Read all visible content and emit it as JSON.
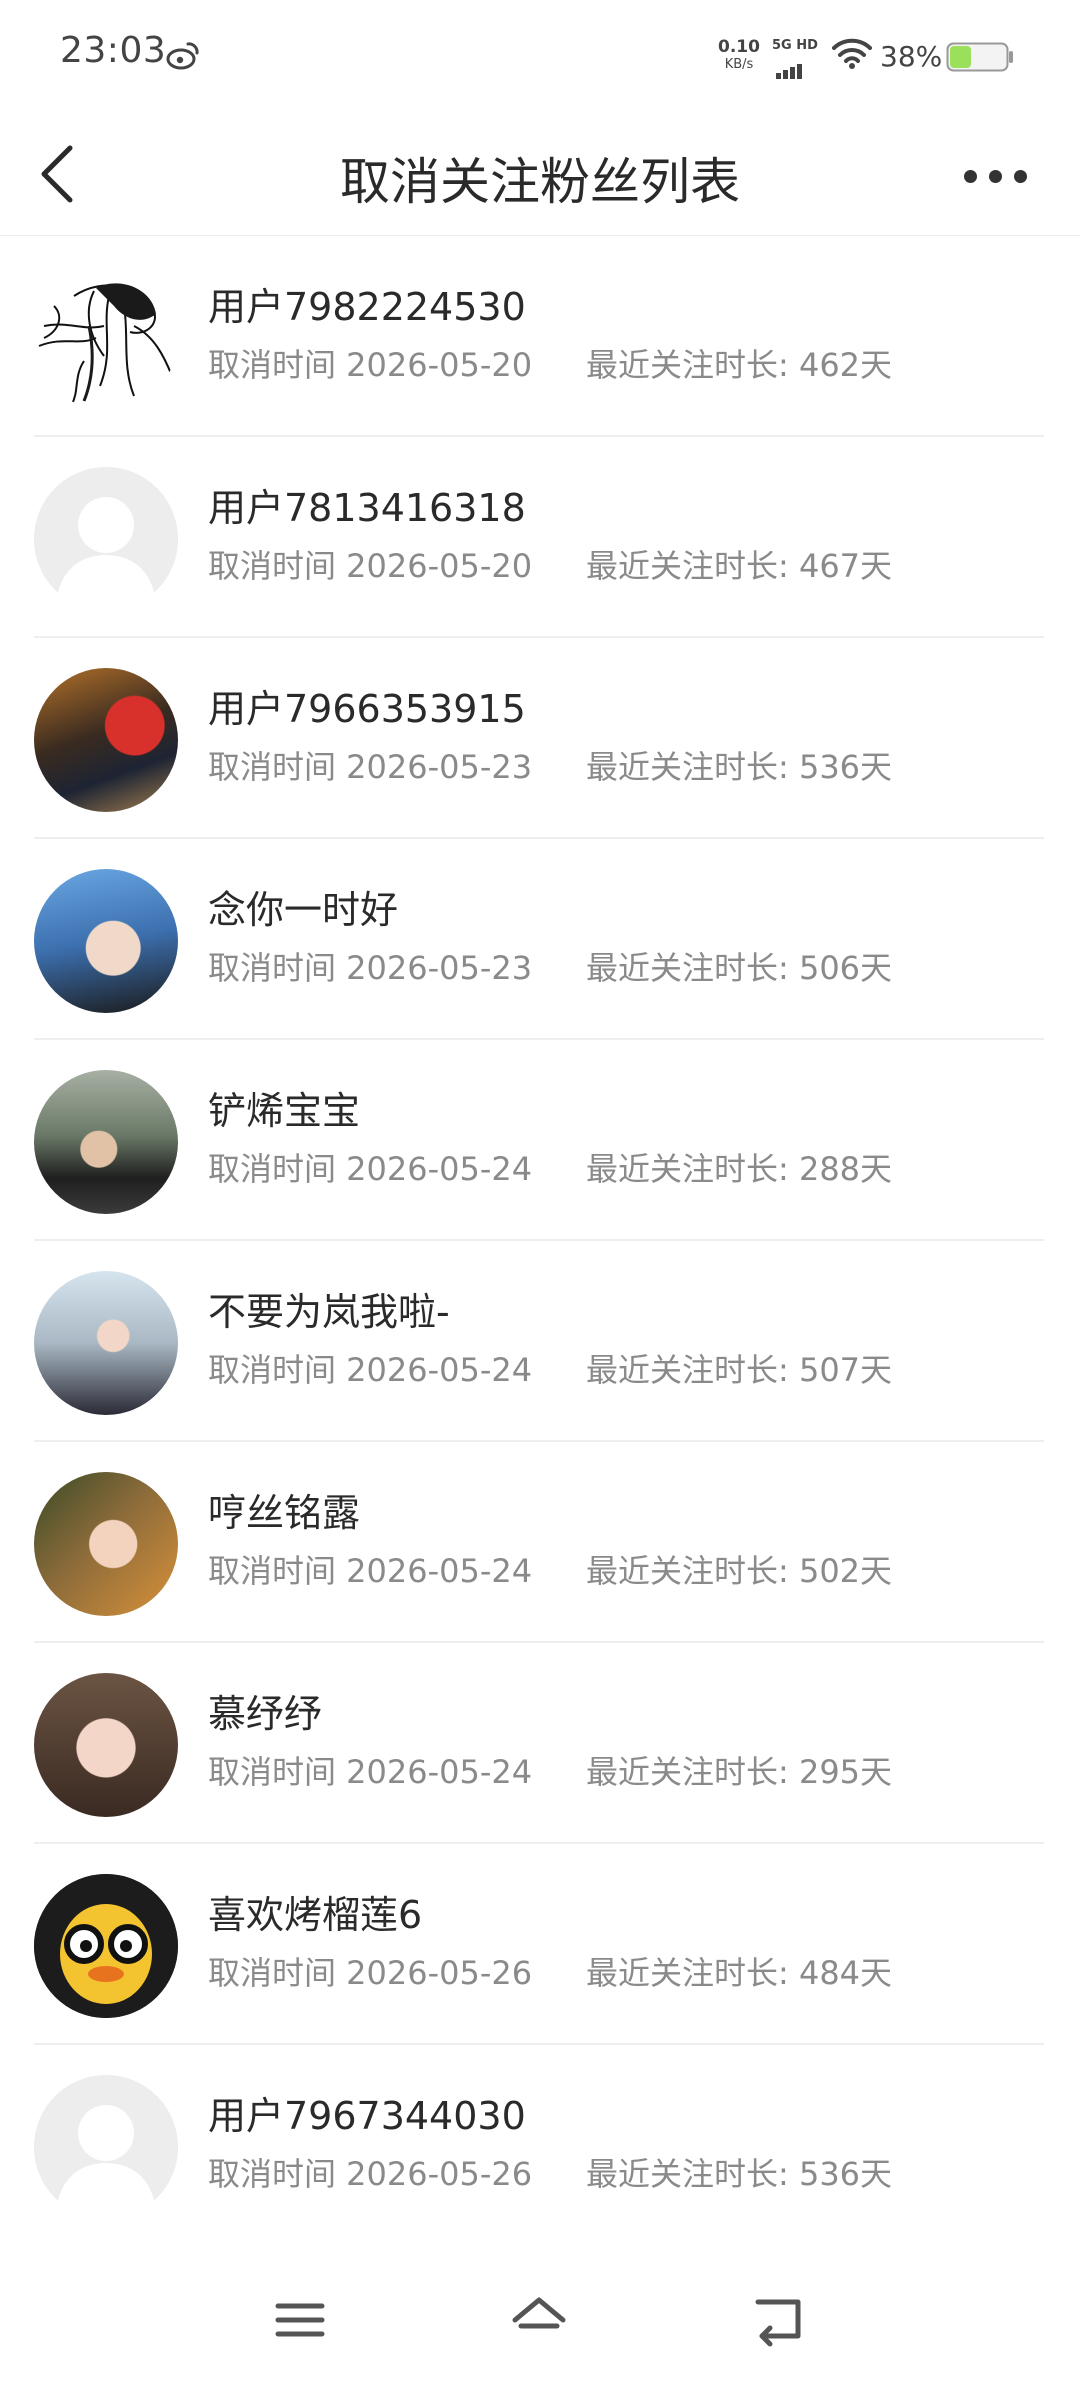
{
  "status_bar": {
    "time": "23:03",
    "net_speed_value": "0.10",
    "net_speed_unit": "KB/s",
    "network_label": "5G HD",
    "battery_percent": "38%",
    "battery_level": 0.38,
    "icons": [
      "weibo-icon",
      "signal-icon",
      "wifi-icon",
      "battery-icon"
    ]
  },
  "header": {
    "title": "取消关注粉丝列表",
    "back_icon": "chevron-left-icon",
    "more_icon": "more-dots-icon"
  },
  "rows": [
    {
      "name": "用户7982224530",
      "cancel": "取消时间 2026-05-20",
      "duration": "最近关注时长: 462天",
      "avatar": "sketch"
    },
    {
      "name": "用户7813416318",
      "cancel": "取消时间 2026-05-20",
      "duration": "最近关注时长: 467天",
      "avatar": "default"
    },
    {
      "name": "用户7966353915",
      "cancel": "取消时间 2026-05-23",
      "duration": "最近关注时长: 536天",
      "avatar": "photo"
    },
    {
      "name": "念你一时好",
      "cancel": "取消时间 2026-05-23",
      "duration": "最近关注时长: 506天",
      "avatar": "photo"
    },
    {
      "name": "铲烯宝宝",
      "cancel": "取消时间 2026-05-24",
      "duration": "最近关注时长: 288天",
      "avatar": "photo"
    },
    {
      "name": "不要为岚我啦-",
      "cancel": "取消时间 2026-05-24",
      "duration": "最近关注时长: 507天",
      "avatar": "photo"
    },
    {
      "name": "哼丝铭露",
      "cancel": "取消时间 2026-05-24",
      "duration": "最近关注时长: 502天",
      "avatar": "photo"
    },
    {
      "name": "慕纾纾",
      "cancel": "取消时间 2026-05-24",
      "duration": "最近关注时长: 295天",
      "avatar": "photo"
    },
    {
      "name": "喜欢烤榴莲6",
      "cancel": "取消时间 2026-05-26",
      "duration": "最近关注时长: 484天",
      "avatar": "photo"
    },
    {
      "name": "用户7967344030",
      "cancel": "取消时间 2026-05-26",
      "duration": "最近关注时长: 536天",
      "avatar": "default"
    }
  ],
  "nav_bar": {
    "icons": [
      "menu-icon",
      "home-icon",
      "back-icon"
    ]
  },
  "colors": {
    "text_primary": "#2a2a2a",
    "text_secondary": "#8a8a8a",
    "divider": "#eeeeee",
    "battery_fill": "#9be05a"
  }
}
